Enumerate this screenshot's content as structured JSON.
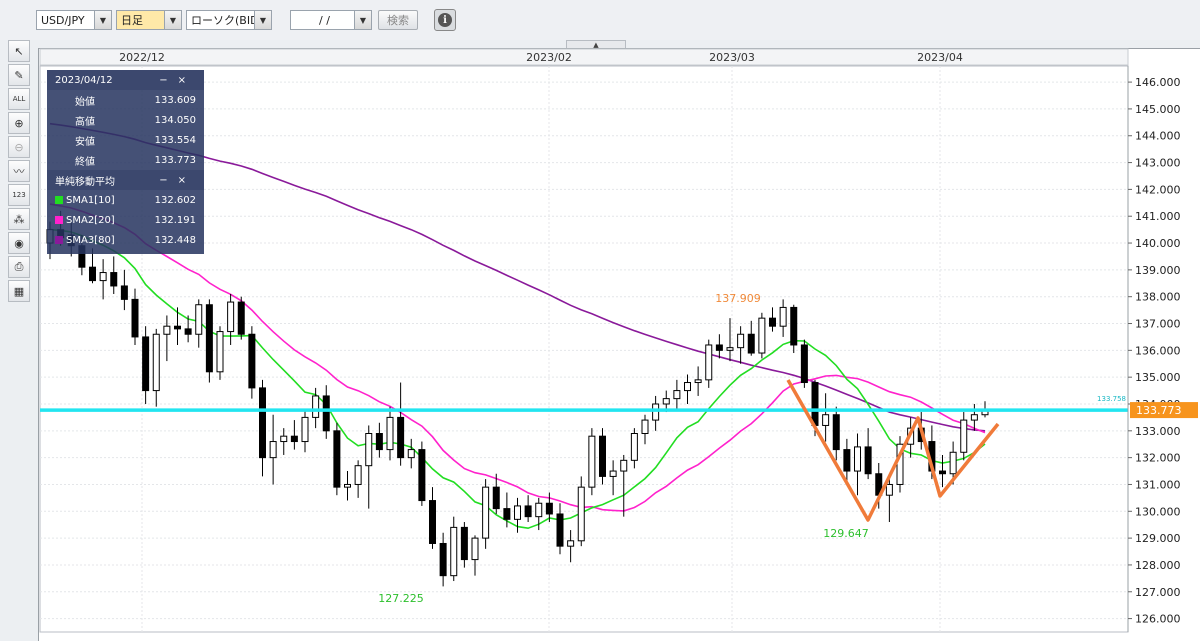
{
  "toolbar": {
    "pair": "USD/JPY",
    "period": "日足",
    "chart_type": "ローソク(BID)",
    "date": "/ /",
    "search": "検索"
  },
  "sidebar_icons": [
    "cursor-icon",
    "pencil-icon",
    "delete-all-icon",
    "zoom-in-icon",
    "zoom-out-icon",
    "indicator-icon",
    "numeric-icon",
    "color-icon",
    "eye-icon",
    "print-icon",
    "table-icon"
  ],
  "info_panel": {
    "date": "2023/04/12",
    "open_label": "始値",
    "open": "133.609",
    "high_label": "高値",
    "high": "134.050",
    "low_label": "安値",
    "low": "133.554",
    "close_label": "終値",
    "close": "133.773",
    "sma_title": "単純移動平均",
    "sma1_label": "SMA1[10]",
    "sma1": "132.602",
    "sma2_label": "SMA2[20]",
    "sma2": "132.191",
    "sma3_label": "SMA3[80]",
    "sma3": "132.448",
    "minimize": "−",
    "close_btn": "×"
  },
  "colors": {
    "sma1": "#22dd22",
    "sma2": "#ff22cc",
    "sma3": "#8a1a9a",
    "hline": "#22e5f0",
    "pattern": "#f07b3a",
    "price_tag": "#f7941d"
  },
  "chart_data": {
    "type": "candlestick",
    "symbol": "USD/JPY",
    "x_labels": [
      "2022/12",
      "2023/02",
      "2023/03",
      "2023/04"
    ],
    "y_ticks": [
      "146.000",
      "145.000",
      "144.000",
      "143.000",
      "142.000",
      "141.000",
      "140.000",
      "139.000",
      "138.000",
      "137.000",
      "136.000",
      "135.000",
      "134.000",
      "133.000",
      "132.000",
      "131.000",
      "130.000",
      "129.000",
      "128.000",
      "127.000",
      "126.000"
    ],
    "ylim": [
      126,
      146
    ],
    "current_price": "133.773",
    "current_price_small": "133.758",
    "annotations": {
      "high": "137.909",
      "low1": "127.225",
      "low2": "129.647"
    },
    "candles": [
      [
        140.0,
        140.8,
        139.4,
        140.5
      ],
      [
        140.5,
        141.2,
        139.9,
        140.2
      ],
      [
        140.3,
        140.9,
        139.5,
        139.9
      ],
      [
        139.9,
        140.3,
        138.8,
        139.1
      ],
      [
        139.1,
        139.8,
        138.5,
        138.6
      ],
      [
        138.6,
        139.4,
        137.9,
        138.9
      ],
      [
        138.9,
        139.5,
        138.1,
        138.4
      ],
      [
        138.4,
        139.0,
        137.5,
        137.9
      ],
      [
        137.9,
        138.3,
        136.2,
        136.5
      ],
      [
        136.5,
        136.9,
        134.0,
        134.5
      ],
      [
        134.5,
        136.8,
        133.9,
        136.6
      ],
      [
        136.6,
        137.3,
        135.6,
        136.9
      ],
      [
        136.9,
        137.6,
        136.2,
        136.8
      ],
      [
        136.8,
        137.3,
        136.3,
        136.6
      ],
      [
        136.6,
        137.9,
        136.1,
        137.7
      ],
      [
        137.7,
        137.9,
        134.8,
        135.2
      ],
      [
        135.2,
        136.9,
        134.9,
        136.7
      ],
      [
        136.7,
        138.1,
        136.2,
        137.8
      ],
      [
        137.8,
        138.0,
        136.4,
        136.6
      ],
      [
        136.6,
        136.9,
        134.2,
        134.6
      ],
      [
        134.6,
        134.9,
        131.3,
        132.0
      ],
      [
        132.0,
        133.6,
        131.0,
        132.6
      ],
      [
        132.6,
        133.1,
        132.1,
        132.8
      ],
      [
        132.8,
        133.4,
        132.3,
        132.6
      ],
      [
        132.6,
        133.8,
        132.2,
        133.5
      ],
      [
        133.5,
        134.6,
        133.1,
        134.3
      ],
      [
        134.3,
        134.7,
        132.7,
        133.0
      ],
      [
        133.0,
        133.3,
        130.6,
        130.9
      ],
      [
        130.9,
        131.5,
        130.4,
        131.0
      ],
      [
        131.0,
        131.9,
        130.5,
        131.7
      ],
      [
        131.7,
        133.2,
        130.1,
        132.9
      ],
      [
        132.9,
        133.3,
        132.0,
        132.3
      ],
      [
        132.3,
        133.9,
        131.9,
        133.5
      ],
      [
        133.5,
        134.8,
        131.7,
        132.0
      ],
      [
        132.0,
        132.7,
        131.6,
        132.3
      ],
      [
        132.3,
        132.6,
        130.2,
        130.4
      ],
      [
        130.4,
        130.9,
        128.6,
        128.8
      ],
      [
        128.8,
        129.2,
        127.2,
        127.6
      ],
      [
        127.6,
        129.8,
        127.4,
        129.4
      ],
      [
        129.4,
        129.6,
        127.9,
        128.2
      ],
      [
        128.2,
        129.1,
        127.6,
        129.0
      ],
      [
        129.0,
        131.2,
        128.6,
        130.9
      ],
      [
        130.9,
        131.4,
        129.9,
        130.1
      ],
      [
        130.1,
        130.7,
        129.4,
        129.7
      ],
      [
        129.7,
        130.5,
        129.2,
        130.2
      ],
      [
        130.2,
        130.6,
        129.6,
        129.8
      ],
      [
        129.8,
        130.5,
        129.3,
        130.3
      ],
      [
        130.3,
        130.7,
        129.6,
        129.9
      ],
      [
        129.9,
        130.3,
        128.4,
        128.7
      ],
      [
        128.7,
        129.3,
        128.1,
        128.9
      ],
      [
        128.9,
        131.3,
        128.7,
        130.9
      ],
      [
        130.9,
        133.1,
        130.6,
        132.8
      ],
      [
        132.8,
        133.1,
        131.0,
        131.3
      ],
      [
        131.3,
        131.9,
        130.6,
        131.5
      ],
      [
        131.5,
        132.1,
        129.8,
        131.9
      ],
      [
        131.9,
        133.1,
        131.6,
        132.9
      ],
      [
        132.9,
        133.6,
        132.5,
        133.4
      ],
      [
        133.4,
        134.3,
        133.0,
        134.0
      ],
      [
        134.0,
        134.5,
        133.7,
        134.2
      ],
      [
        134.2,
        134.9,
        133.8,
        134.5
      ],
      [
        134.5,
        135.1,
        134.0,
        134.8
      ],
      [
        134.8,
        135.4,
        134.3,
        134.9
      ],
      [
        134.9,
        136.4,
        134.6,
        136.2
      ],
      [
        136.2,
        136.6,
        135.7,
        136.0
      ],
      [
        136.0,
        137.2,
        135.6,
        136.1
      ],
      [
        136.1,
        136.9,
        135.5,
        136.6
      ],
      [
        136.6,
        137.1,
        135.8,
        135.9
      ],
      [
        135.9,
        137.4,
        135.7,
        137.2
      ],
      [
        137.2,
        137.6,
        136.7,
        136.9
      ],
      [
        136.9,
        137.9,
        136.5,
        137.6
      ],
      [
        137.6,
        137.7,
        135.9,
        136.2
      ],
      [
        136.2,
        136.4,
        134.6,
        134.8
      ],
      [
        134.8,
        134.9,
        132.8,
        133.2
      ],
      [
        133.2,
        134.4,
        132.6,
        133.6
      ],
      [
        133.6,
        133.9,
        131.9,
        132.3
      ],
      [
        132.3,
        132.7,
        131.1,
        131.5
      ],
      [
        131.5,
        132.9,
        130.6,
        132.4
      ],
      [
        132.4,
        133.1,
        131.2,
        131.4
      ],
      [
        131.4,
        131.8,
        130.1,
        130.6
      ],
      [
        130.6,
        131.3,
        129.6,
        131.0
      ],
      [
        131.0,
        132.8,
        130.7,
        132.5
      ],
      [
        132.5,
        133.5,
        132.0,
        133.1
      ],
      [
        133.1,
        133.7,
        132.3,
        132.6
      ],
      [
        132.6,
        133.2,
        131.2,
        131.5
      ],
      [
        131.5,
        132.1,
        130.9,
        131.4
      ],
      [
        131.4,
        132.6,
        131.0,
        132.2
      ],
      [
        132.2,
        133.7,
        131.9,
        133.4
      ],
      [
        133.4,
        134.0,
        133.0,
        133.6
      ],
      [
        133.6,
        134.1,
        133.5,
        133.8
      ]
    ]
  }
}
